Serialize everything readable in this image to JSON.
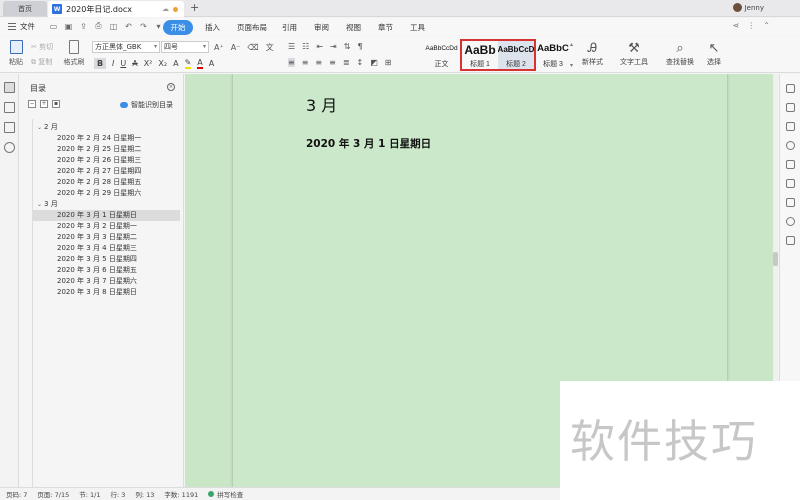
{
  "titlebar": {
    "home_tab": "首页",
    "doc_tab": "2020年日记.docx",
    "new_tab": "+",
    "user_name": "Jenny"
  },
  "menubar": {
    "file": "文件",
    "tabs": [
      "开始",
      "插入",
      "页面布局",
      "引用",
      "审阅",
      "视图",
      "章节",
      "工具"
    ],
    "active_tab": "开始"
  },
  "ribbon": {
    "paste": "粘贴",
    "cut": "剪切",
    "copy": "复制",
    "format_painter": "格式刷",
    "font_name": "方正黑体_GBK",
    "font_size": "四号",
    "styles": [
      {
        "preview": "AaBbCcDd",
        "name": "正文"
      },
      {
        "preview": "AaBb",
        "name": "标题 1"
      },
      {
        "preview": "AaBbCcD",
        "name": "标题 2"
      },
      {
        "preview": "AaBbC",
        "name": "标题 3"
      }
    ],
    "new_style": "新样式",
    "text_tools": "文字工具",
    "find_replace": "查找替换",
    "select": "选择"
  },
  "toc": {
    "title": "目录",
    "smart_label": "智能识别目录",
    "items": [
      {
        "level": 1,
        "text": "2 月"
      },
      {
        "level": 2,
        "text": "2020 年 2 月 24 日星期一"
      },
      {
        "level": 2,
        "text": "2020 年 2 月 25 日星期二"
      },
      {
        "level": 2,
        "text": "2020 年 2 月 26 日星期三"
      },
      {
        "level": 2,
        "text": "2020 年 2 月 27 日星期四"
      },
      {
        "level": 2,
        "text": "2020 年 2 月 28 日星期五"
      },
      {
        "level": 2,
        "text": "2020 年 2 月 29 日星期六"
      },
      {
        "level": 1,
        "text": "3 月"
      },
      {
        "level": 2,
        "text": "2020 年 3 月 1 日星期日",
        "selected": true
      },
      {
        "level": 2,
        "text": "2020 年 3 月 2 日星期一"
      },
      {
        "level": 2,
        "text": "2020 年 3 月 3 日星期二"
      },
      {
        "level": 2,
        "text": "2020 年 3 月 4 日星期三"
      },
      {
        "level": 2,
        "text": "2020 年 3 月 5 日星期四"
      },
      {
        "level": 2,
        "text": "2020 年 3 月 6 日星期五"
      },
      {
        "level": 2,
        "text": "2020 年 3 月 7 日星期六"
      },
      {
        "level": 2,
        "text": "2020 年 3 月 8 日星期日"
      }
    ]
  },
  "document": {
    "heading1": "3 月",
    "heading2": "2020 年 3 月 1 日星期日",
    "background_color": "#cce8cb"
  },
  "status": {
    "page": "页码: 7",
    "pages": "页面: 7/15",
    "section": "节: 1/1",
    "row": "行: 3",
    "col": "列: 13",
    "word_count": "字数: 1191",
    "spell_check": "拼写检查"
  },
  "watermark": {
    "text": "软件技巧"
  },
  "colors": {
    "accent": "#3a8ee6",
    "highlight_border": "#d63333"
  }
}
